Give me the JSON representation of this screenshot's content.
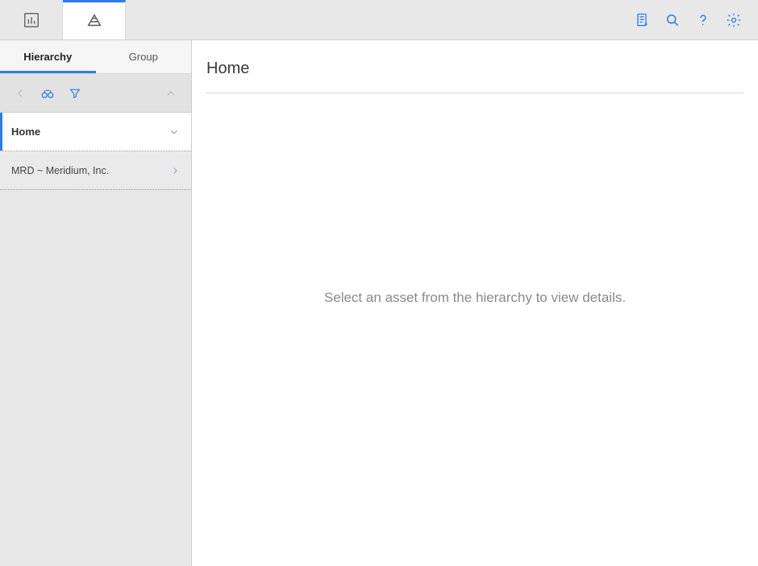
{
  "topbar": {
    "tabs": [
      {
        "name": "dashboard",
        "active": false
      },
      {
        "name": "hierarchy",
        "active": true
      }
    ],
    "right_icons": [
      "clipboard",
      "search",
      "help",
      "settings"
    ]
  },
  "sidebar": {
    "tabs": [
      {
        "label": "Hierarchy",
        "active": true
      },
      {
        "label": "Group",
        "active": false
      }
    ],
    "toolbelt": {
      "back_disabled": true,
      "icons": [
        "binoculars",
        "filter"
      ],
      "collapse_disabled": true
    },
    "tree": {
      "home_label": "Home",
      "items": [
        {
          "label": "MRD ~ Meridium, Inc."
        }
      ]
    }
  },
  "content": {
    "title": "Home",
    "empty_message": "Select an asset from the hierarchy to view details."
  }
}
